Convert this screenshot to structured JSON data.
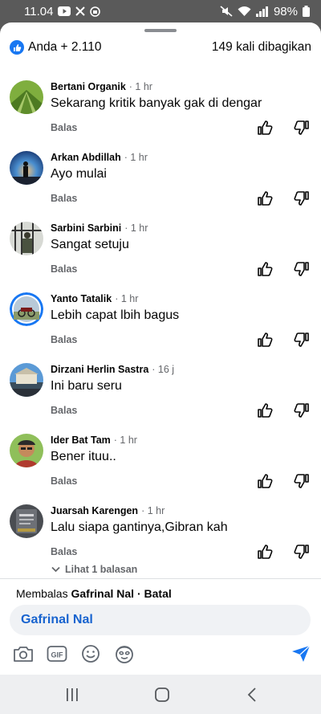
{
  "status_bar": {
    "time": "11.04",
    "battery": "98%"
  },
  "summary": {
    "reactions_label": "Anda + 2.110",
    "shares_label": "149 kali dibagikan"
  },
  "comments": [
    {
      "name": "Bertani Organik",
      "time": "· 1 hr",
      "text": "Sekarang kritik banyak gak di dengar",
      "reply_label": "Balas"
    },
    {
      "name": "Arkan Abdillah",
      "time": "· 1 hr",
      "text": "Ayo mulai",
      "reply_label": "Balas"
    },
    {
      "name": "Sarbini Sarbini",
      "time": "· 1 hr",
      "text": "Sangat setuju",
      "reply_label": "Balas"
    },
    {
      "name": "Yanto Tatalik",
      "time": "· 1 hr",
      "text": "Lebih capat lbih bagus",
      "reply_label": "Balas"
    },
    {
      "name": "Dirzani Herlin Sastra",
      "time": "· 16 j",
      "text": "Ini baru seru",
      "reply_label": "Balas"
    },
    {
      "name": "Ider Bat Tam",
      "time": "· 1 hr",
      "text": "Bener ituu..",
      "reply_label": "Balas"
    },
    {
      "name": "Juarsah Karengen",
      "time": "· 1 hr",
      "text": "Lalu siapa gantinya,Gibran kah",
      "reply_label": "Balas",
      "view_replies": "Lihat 1 balasan"
    }
  ],
  "composer": {
    "replying_prefix": "Membalas",
    "replying_to": "Gafrinal Nal",
    "cancel_label": "· Batal",
    "input_value": "Gafrinal Nal"
  },
  "colors": {
    "accent": "#1877f2",
    "mention": "#1763cf",
    "secondary_text": "#65676b"
  }
}
